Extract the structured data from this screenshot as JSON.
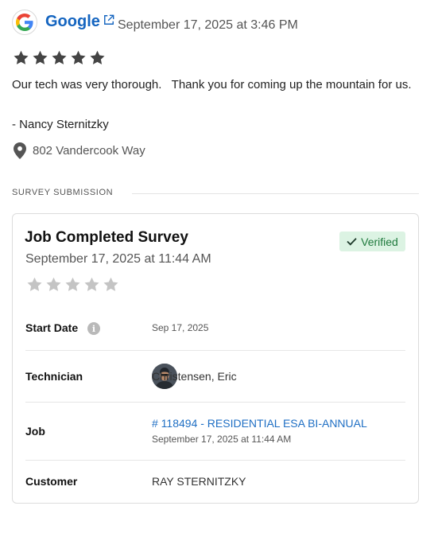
{
  "review": {
    "source_name": "Google",
    "date": "September 17, 2025 at 3:46 PM",
    "rating": 5,
    "rating_max": 5,
    "text": "Our tech was very thorough.   Thank you for coming up the mountain for us.",
    "author": "- Nancy Sternitzky",
    "location": "802 Vandercook Way",
    "icons": {
      "source": "google-logo-icon",
      "link": "external-link-icon",
      "star": "star-icon",
      "location": "map-pin-icon"
    }
  },
  "survey": {
    "section_label": "SURVEY SUBMISSION",
    "title": "Job Completed Survey",
    "date": "September 17, 2025 at 11:44 AM",
    "status": "Verified",
    "rating": 0,
    "rating_max": 5,
    "rows": {
      "start_date": {
        "label": "Start Date",
        "value": "Sep 17, 2025"
      },
      "technician": {
        "label": "Technician",
        "value": "Christensen, Eric"
      },
      "job": {
        "label": "Job",
        "value": "# 118494 - RESIDENTIAL ESA BI-ANNUAL",
        "sub": "September 17, 2025 at 11:44 AM"
      },
      "customer": {
        "label": "Customer",
        "value": "RAY STERNITZKY"
      }
    }
  },
  "colors": {
    "link": "#1565c0",
    "verified_bg": "#dcf3e3",
    "verified_text": "#1f7a3d",
    "star_filled": "#444444",
    "star_empty": "#c4c4c4"
  }
}
